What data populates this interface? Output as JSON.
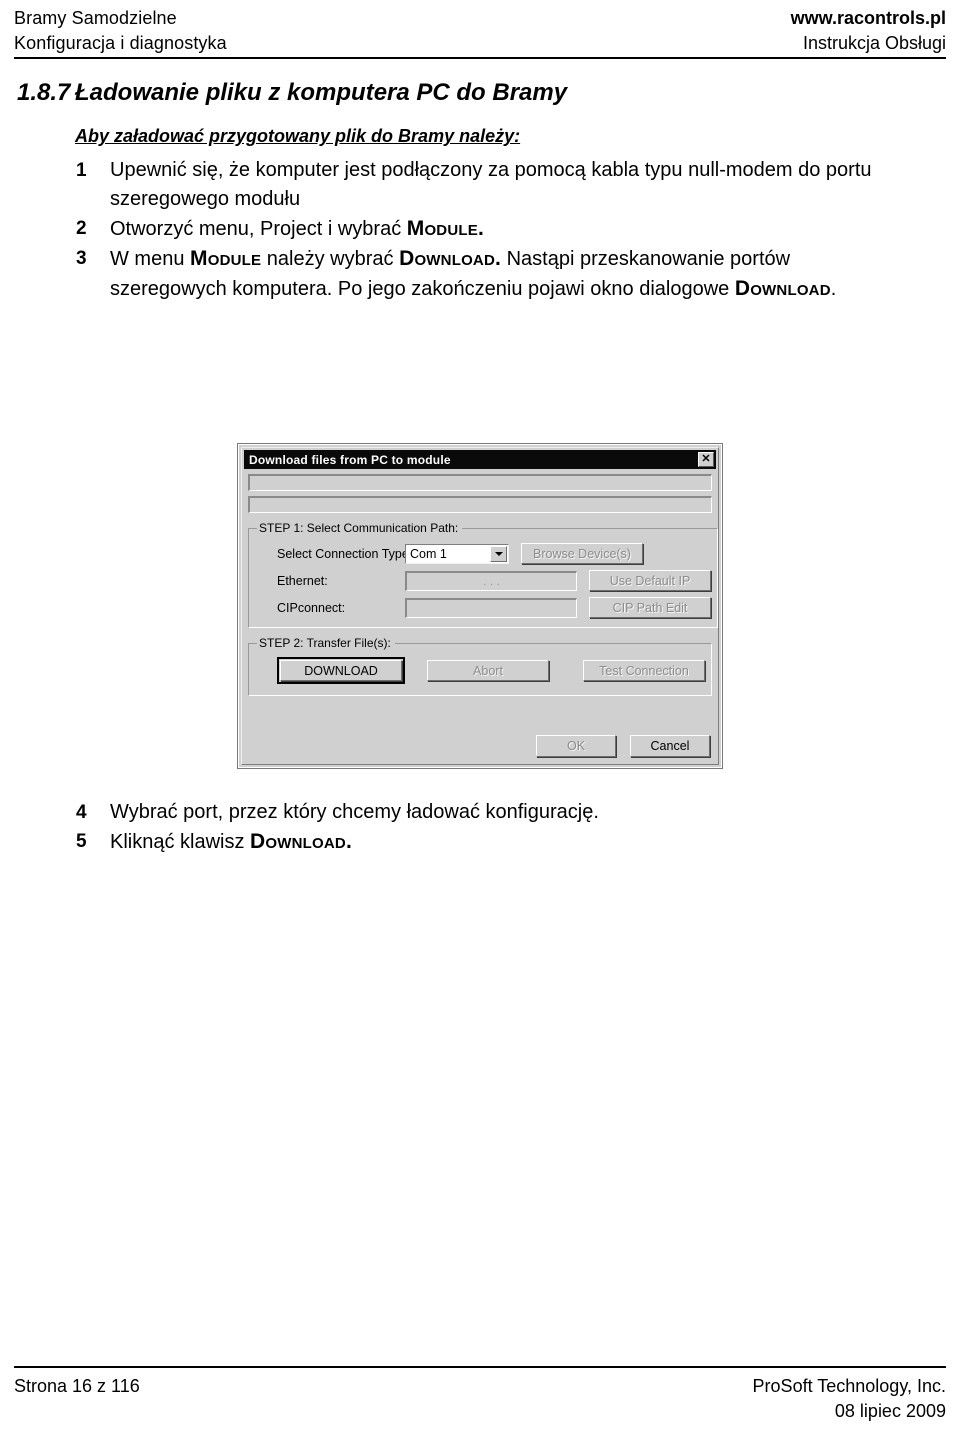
{
  "header": {
    "left_line1": "Bramy Samodzielne",
    "left_line2": "Konfiguracja i diagnostyka",
    "right_line1": "www.racontrols.pl",
    "right_line2": "Instrukcja Obsługi"
  },
  "section": {
    "number": "1.8.7",
    "title": "Ładowanie pliku z komputera PC do Bramy",
    "lead": "Aby załadować przygotowany plik do Bramy należy:"
  },
  "steps": {
    "item1_num": "1",
    "item1_text": "Upewnić się, że komputer jest podłączony za pomocą kabla typu null-modem do portu szeregowego modułu",
    "item2_num": "2",
    "item2_a": "Otworzyć menu,  Project  i wybrać ",
    "item2_b": "Module.",
    "item3_num": "3",
    "item3_a": "W menu ",
    "item3_b": "Module",
    "item3_c": " należy wybrać ",
    "item3_d": "Download.",
    "item3_e": " Nastąpi przeskanowanie portów szeregowych komputera. Po jego zakończeniu pojawi okno dialogowe ",
    "item3_f": "Download",
    "item3_g": ".",
    "item4_num": "4",
    "item4_text": "Wybrać port, przez który chcemy ładować konfigurację.",
    "item5_num": "5",
    "item5_a": "Kliknąć klawisz ",
    "item5_b": "Download."
  },
  "dialog": {
    "title": "Download files from PC to module",
    "close_label": "✕",
    "step1": {
      "legend": "STEP 1: Select Communication Path:",
      "connection_type_label": "Select Connection Type:",
      "connection_type_value": "Com 1",
      "browse_devices_label": "Browse Device(s)",
      "ethernet_label": "Ethernet:",
      "ethernet_value": ".   .   .",
      "use_default_ip_label": "Use Default IP",
      "cipconnect_label": "CIPconnect:",
      "cipconnect_value": "",
      "cip_path_edit_label": "CIP Path Edit"
    },
    "step2": {
      "legend": "STEP 2: Transfer File(s):",
      "download_label": "DOWNLOAD",
      "abort_label": "Abort",
      "test_connection_label": "Test Connection"
    },
    "ok_label": "OK",
    "cancel_label": "Cancel"
  },
  "footer": {
    "left": "Strona  16 z 116",
    "right_line1": "ProSoft Technology, Inc.",
    "right_line2": "08 lipiec 2009"
  }
}
